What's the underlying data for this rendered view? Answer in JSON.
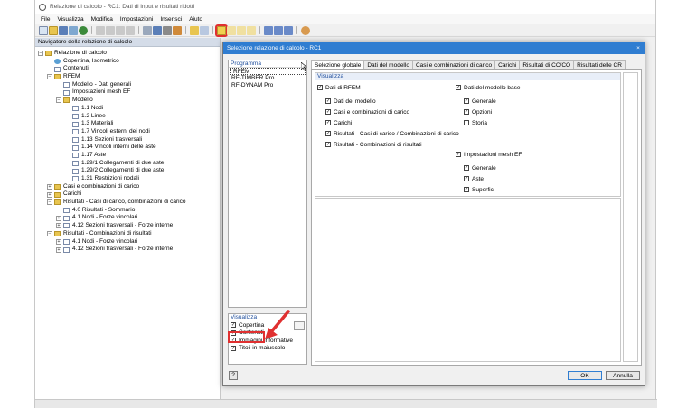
{
  "window": {
    "title": "Relazione di calcolo - RC1: Dati di input e risultati ridotti"
  },
  "menu": [
    "File",
    "Visualizza",
    "Modifica",
    "Impostazioni",
    "Inserisci",
    "Aiuto"
  ],
  "navigator": {
    "header": "Navigatore della relazione di calcolo",
    "items": [
      {
        "label": "Relazione di calcolo",
        "exp": "−",
        "icon": "folder"
      },
      {
        "label": "Copertina, Isometrico",
        "exp": "",
        "icon": "eye"
      },
      {
        "label": "Contenuti",
        "exp": "",
        "icon": "page"
      },
      {
        "label": "RFEM",
        "exp": "−",
        "icon": "folder"
      },
      {
        "label": "Modello - Dati generali",
        "exp": "",
        "icon": "page"
      },
      {
        "label": "Impostazioni mesh EF",
        "exp": "",
        "icon": "page"
      },
      {
        "label": "Modello",
        "exp": "−",
        "icon": "folder"
      },
      {
        "label": "1.1 Nodi",
        "exp": "",
        "icon": "page"
      },
      {
        "label": "1.2 Linee",
        "exp": "",
        "icon": "page"
      },
      {
        "label": "1.3 Materiali",
        "exp": "",
        "icon": "page"
      },
      {
        "label": "1.7 Vincoli esterni dei nodi",
        "exp": "",
        "icon": "page"
      },
      {
        "label": "1.13 Sezioni trasversali",
        "exp": "",
        "icon": "page"
      },
      {
        "label": "1.14 Vincoli interni delle aste",
        "exp": "",
        "icon": "page"
      },
      {
        "label": "1.17 Aste",
        "exp": "",
        "icon": "page"
      },
      {
        "label": "1.29/1 Collegamenti di due aste",
        "exp": "",
        "icon": "page"
      },
      {
        "label": "1.29/2 Collegamenti di due aste",
        "exp": "",
        "icon": "page"
      },
      {
        "label": "1.31 Restrizioni nodali",
        "exp": "",
        "icon": "page"
      },
      {
        "label": "Casi e combinazioni di carico",
        "exp": "+",
        "icon": "folder"
      },
      {
        "label": "Carichi",
        "exp": "+",
        "icon": "folder"
      },
      {
        "label": "Risultati - Casi di carico, combinazioni di carico",
        "exp": "−",
        "icon": "folder"
      },
      {
        "label": "4.0 Risultati - Sommario",
        "exp": "",
        "icon": "page"
      },
      {
        "label": "4.1 Nodi - Forze vincolari",
        "exp": "+",
        "icon": "page"
      },
      {
        "label": "4.12 Sezioni trasversali - Forze interne",
        "exp": "+",
        "icon": "page"
      },
      {
        "label": "Risultati - Combinazioni di risultati",
        "exp": "−",
        "icon": "folder"
      },
      {
        "label": "4.1 Nodi - Forze vincolari",
        "exp": "+",
        "icon": "page"
      },
      {
        "label": "4.12 Sezioni trasversali - Forze interne",
        "exp": "+",
        "icon": "page"
      }
    ]
  },
  "dialog": {
    "title": "Selezione relazione di calcolo - RC1",
    "close": "×",
    "programs_header": "Programma",
    "programs": [
      "RFEM",
      "RF-TIMBER Pro",
      "RF-DYNAM Pro"
    ],
    "visual_header": "Visualizza",
    "visual_items": [
      {
        "label": "Copertina",
        "checked": true
      },
      {
        "label": "Contenuti",
        "checked": true
      },
      {
        "label": "Immagini informative",
        "checked": true
      },
      {
        "label": "Titoli in maiuscolo",
        "checked": true
      }
    ],
    "tabs": [
      "Selezione globale",
      "Dati del modello",
      "Casi e combinazioni di carico",
      "Carichi",
      "Risultati di CC/CO",
      "Risultati delle CR"
    ],
    "group_header": "Visualizza",
    "left_col": [
      {
        "label": "Dati di RFEM",
        "indent": 0
      },
      {
        "label": "Dati del modello",
        "indent": 1
      },
      {
        "label": "Casi e combinazioni di carico",
        "indent": 1
      },
      {
        "label": "Carichi",
        "indent": 1
      },
      {
        "label": "Risultati - Casi di carico / Combinazioni di carico",
        "indent": 1
      },
      {
        "label": "Risultati - Combinazioni di risultati",
        "indent": 1
      }
    ],
    "right_col1": [
      {
        "label": "Dati del modello base",
        "indent": 0
      },
      {
        "label": "Generale",
        "indent": 1
      },
      {
        "label": "Opzioni",
        "indent": 1
      },
      {
        "label": "Storia",
        "indent": 1,
        "checked": false
      }
    ],
    "right_col2": [
      {
        "label": "Impostazioni mesh EF",
        "indent": 0
      },
      {
        "label": "Generale",
        "indent": 1
      },
      {
        "label": "Aste",
        "indent": 1
      },
      {
        "label": "Superfici",
        "indent": 1
      }
    ],
    "ok": "OK",
    "cancel": "Annulla",
    "help": "?"
  },
  "colors": {
    "accent": "#2f7dd1",
    "highlight": "#e03030",
    "folder": "#e8c550"
  }
}
